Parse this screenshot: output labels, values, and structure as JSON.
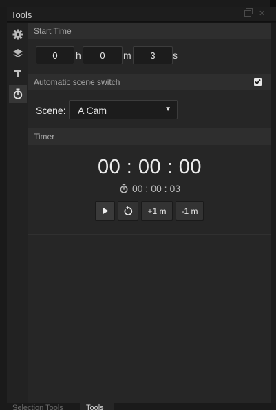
{
  "window": {
    "title": "Tools"
  },
  "sidebar": {
    "items": [
      {
        "icon": "gear-icon",
        "active": false
      },
      {
        "icon": "layers-icon",
        "active": false
      },
      {
        "icon": "text-icon",
        "active": false
      },
      {
        "icon": "stopwatch-icon",
        "active": true
      }
    ]
  },
  "start_time": {
    "header": "Start Time",
    "hours": "0",
    "hours_unit": "h",
    "minutes": "0",
    "minutes_unit": "m",
    "seconds": "3",
    "seconds_unit": "s"
  },
  "auto_switch": {
    "header": "Automatic scene switch",
    "checked": true
  },
  "scene": {
    "label": "Scene:",
    "selected": "A Cam"
  },
  "timer": {
    "header": "Timer",
    "display": "00 : 00 : 00",
    "preset": "00 : 00 : 03",
    "plus_label": "+1 m",
    "minus_label": "-1 m"
  },
  "bottom_tabs": [
    {
      "label": "Selection Tools",
      "active": false
    },
    {
      "label": "Tools",
      "active": true
    }
  ],
  "colors": {
    "panel_bg": "#262626",
    "header_bg": "#2e2e2e",
    "sidebar_bg": "#222222",
    "field_bg": "#1c1c1c"
  }
}
